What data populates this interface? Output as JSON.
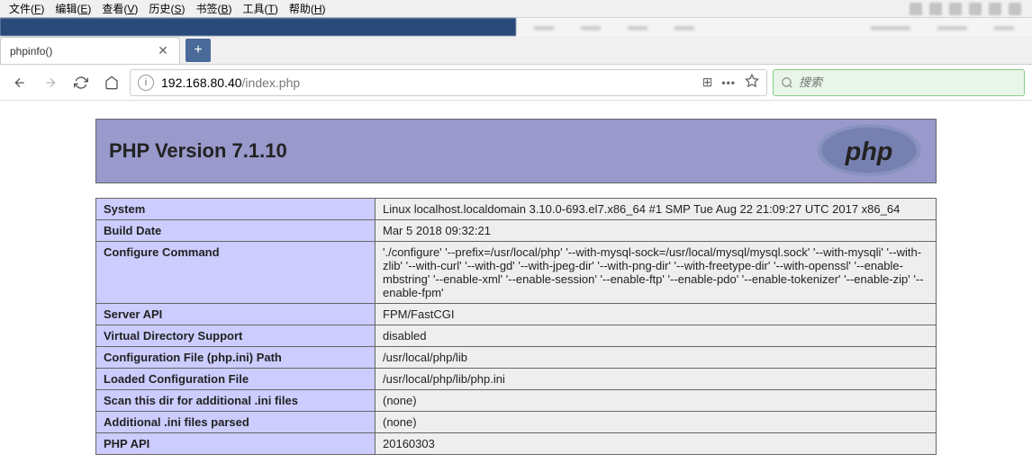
{
  "menubar": {
    "items": [
      {
        "label": "文件",
        "key": "F"
      },
      {
        "label": "编辑",
        "key": "E"
      },
      {
        "label": "查看",
        "key": "V"
      },
      {
        "label": "历史",
        "key": "S"
      },
      {
        "label": "书签",
        "key": "B"
      },
      {
        "label": "工具",
        "key": "T"
      },
      {
        "label": "帮助",
        "key": "H"
      }
    ]
  },
  "tab": {
    "title": "phpinfo()"
  },
  "urlbar": {
    "host": "192.168.80.40",
    "path": "/index.php"
  },
  "searchbar": {
    "placeholder": "搜索"
  },
  "phpinfo": {
    "title": "PHP Version 7.1.10",
    "rows": [
      {
        "k": "System",
        "v": "Linux localhost.localdomain 3.10.0-693.el7.x86_64 #1 SMP Tue Aug 22 21:09:27 UTC 2017 x86_64"
      },
      {
        "k": "Build Date",
        "v": "Mar 5 2018 09:32:21"
      },
      {
        "k": "Configure Command",
        "v": "'./configure' '--prefix=/usr/local/php' '--with-mysql-sock=/usr/local/mysql/mysql.sock' '--with-mysqli' '--with-zlib' '--with-curl' '--with-gd' '--with-jpeg-dir' '--with-png-dir' '--with-freetype-dir' '--with-openssl' '--enable-mbstring' '--enable-xml' '--enable-session' '--enable-ftp' '--enable-pdo' '--enable-tokenizer' '--enable-zip' '--enable-fpm'"
      },
      {
        "k": "Server API",
        "v": "FPM/FastCGI"
      },
      {
        "k": "Virtual Directory Support",
        "v": "disabled"
      },
      {
        "k": "Configuration File (php.ini) Path",
        "v": "/usr/local/php/lib"
      },
      {
        "k": "Loaded Configuration File",
        "v": "/usr/local/php/lib/php.ini"
      },
      {
        "k": "Scan this dir for additional .ini files",
        "v": "(none)"
      },
      {
        "k": "Additional .ini files parsed",
        "v": "(none)"
      },
      {
        "k": "PHP API",
        "v": "20160303"
      }
    ]
  }
}
